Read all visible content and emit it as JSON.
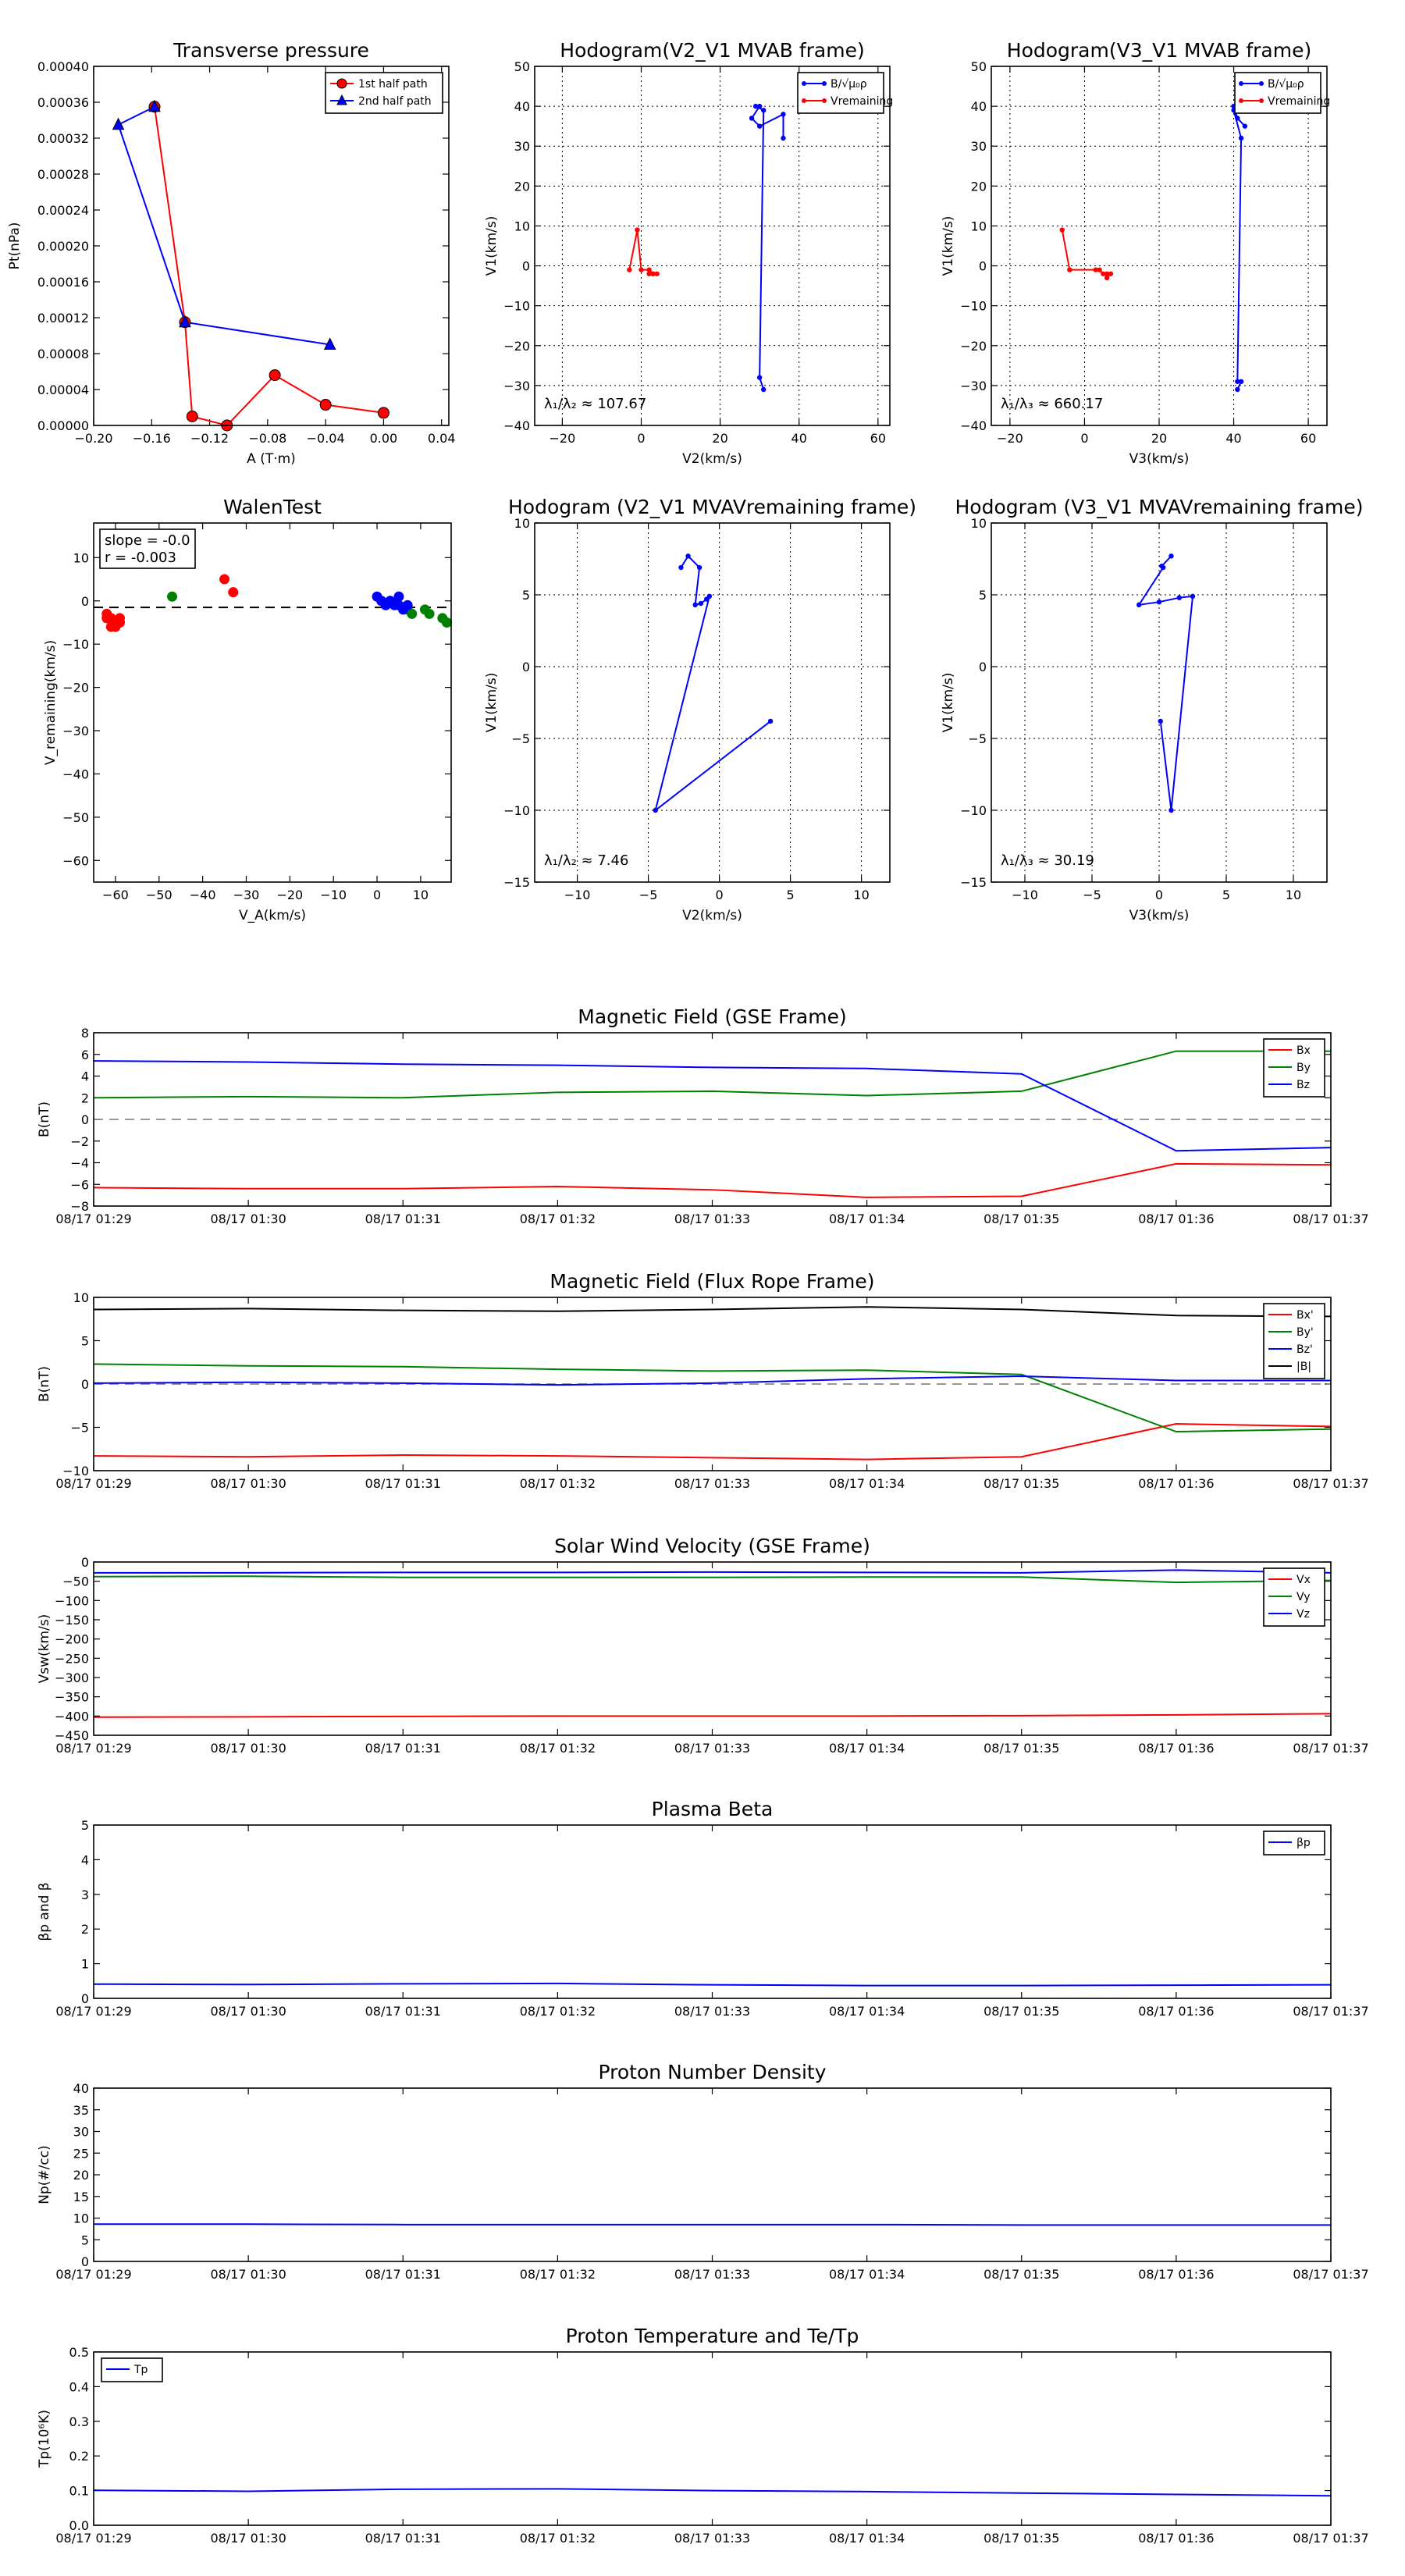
{
  "chart_data": [
    {
      "id": "transverse-pressure",
      "type": "line",
      "title": "Transverse pressure",
      "xlabel": "A (T·m)",
      "ylabel": "Pt(nPa)",
      "xlim": [
        -0.2,
        0.045
      ],
      "ylim": [
        0,
        0.0004
      ],
      "xticks": [
        -0.2,
        -0.16,
        -0.12,
        -0.08,
        -0.04,
        0.0,
        0.04
      ],
      "xtick_labels": [
        "−0.20",
        "−0.16",
        "−0.12",
        "−0.08",
        "−0.04",
        "0.00",
        "0.04"
      ],
      "yticks": [
        0,
        4e-05,
        8e-05,
        0.00012,
        0.00016,
        0.0002,
        0.00024,
        0.00028,
        0.00032,
        0.00036,
        0.0004
      ],
      "ytick_labels": [
        "0.00000",
        "0.00004",
        "0.00008",
        "0.00012",
        "0.00016",
        "0.00020",
        "0.00024",
        "0.00028",
        "0.00032",
        "0.00036",
        "0.00040"
      ],
      "grid": false,
      "legend": "top-right",
      "series": [
        {
          "name": "1st half path",
          "color": "#ff0000",
          "marker": "circle",
          "x": [
            -0.158,
            -0.137,
            -0.132,
            -0.108,
            -0.075,
            -0.04,
            0.0
          ],
          "y": [
            0.000355,
            0.000115,
            1e-05,
            0.0,
            5.6e-05,
            2.3e-05,
            1.4e-05
          ]
        },
        {
          "name": "2nd half path",
          "color": "#0000ff",
          "marker": "triangle",
          "x": [
            -0.037,
            -0.137,
            -0.183,
            -0.158
          ],
          "y": [
            9e-05,
            0.000115,
            0.000335,
            0.000355
          ]
        }
      ]
    },
    {
      "id": "hodogram-v2v1-mvab",
      "type": "line",
      "title": "Hodogram(V2_V1 MVAB frame)",
      "xlabel": "V2(km/s)",
      "ylabel": "V1(km/s)",
      "xlim": [
        -27,
        63
      ],
      "ylim": [
        -40,
        50
      ],
      "xticks": [
        -20,
        0,
        20,
        40,
        60
      ],
      "xtick_labels": [
        "−20",
        "0",
        "20",
        "40",
        "60"
      ],
      "yticks": [
        -40,
        -30,
        -20,
        -10,
        0,
        10,
        20,
        30,
        40,
        50
      ],
      "ytick_labels": [
        "−40",
        "−30",
        "−20",
        "−10",
        "0",
        "10",
        "20",
        "30",
        "40",
        "50"
      ],
      "grid": true,
      "legend": "top-right",
      "annotation": "λ₁/λ₂ ≈ 107.67",
      "series": [
        {
          "name": "B/√μ₀ρ",
          "color": "#0000ff",
          "marker": "dot",
          "x": [
            36,
            36,
            30,
            28,
            30,
            29,
            31,
            30,
            31
          ],
          "y": [
            32,
            38,
            35,
            37,
            40,
            40,
            39,
            -28,
            -31
          ]
        },
        {
          "name": "Vremaining",
          "color": "#ff0000",
          "marker": "dot",
          "x": [
            -3,
            -1,
            0,
            2,
            3,
            4,
            2,
            3
          ],
          "y": [
            -1,
            9,
            -1,
            -1,
            -2,
            -2,
            -2,
            -2
          ]
        }
      ]
    },
    {
      "id": "hodogram-v3v1-mvab",
      "type": "line",
      "title": "Hodogram(V3_V1 MVAB frame)",
      "xlabel": "V3(km/s)",
      "ylabel": "V1(km/s)",
      "xlim": [
        -25,
        65
      ],
      "ylim": [
        -40,
        50
      ],
      "xticks": [
        -20,
        0,
        20,
        40,
        60
      ],
      "xtick_labels": [
        "−20",
        "0",
        "20",
        "40",
        "60"
      ],
      "yticks": [
        -40,
        -30,
        -20,
        -10,
        0,
        10,
        20,
        30,
        40,
        50
      ],
      "ytick_labels": [
        "−40",
        "−30",
        "−20",
        "−10",
        "0",
        "10",
        "20",
        "30",
        "40",
        "50"
      ],
      "grid": true,
      "legend": "top-right",
      "annotation": "λ₁/λ₃ ≈ 660.17",
      "series": [
        {
          "name": "B/√μ₀ρ",
          "color": "#0000ff",
          "marker": "dot",
          "x": [
            43,
            41,
            40,
            41,
            40,
            42,
            41,
            42,
            41
          ],
          "y": [
            35,
            37,
            40,
            40,
            39,
            32,
            -29,
            -29,
            -31
          ]
        },
        {
          "name": "Vremaining",
          "color": "#ff0000",
          "marker": "dot",
          "x": [
            -6,
            -4,
            3,
            4,
            5,
            6,
            7,
            6
          ],
          "y": [
            9,
            -1,
            -1,
            -1,
            -2,
            -2,
            -2,
            -3
          ]
        }
      ]
    },
    {
      "id": "walen-test",
      "type": "scatter",
      "title": "WalenTest",
      "xlabel": "V_A(km/s)",
      "ylabel": "V_remaining(km/s)",
      "xlim": [
        -65,
        17
      ],
      "ylim": [
        -65,
        18
      ],
      "xticks": [
        -60,
        -50,
        -40,
        -30,
        -20,
        -10,
        0,
        10
      ],
      "xtick_labels": [
        "−60",
        "−50",
        "−40",
        "−30",
        "−20",
        "−10",
        "0",
        "10"
      ],
      "yticks": [
        -60,
        -50,
        -40,
        -30,
        -20,
        -10,
        0,
        10
      ],
      "ytick_labels": [
        "−60",
        "−50",
        "−40",
        "−30",
        "−20",
        "−10",
        "0",
        "10"
      ],
      "grid": false,
      "fit_line": {
        "slope": -0.0,
        "intercept": -1.5
      },
      "annotation_lines": [
        "slope = -0.0",
        "r = -0.003"
      ],
      "series": [
        {
          "color": "#ff0000",
          "x": [
            -62,
            -61,
            -60,
            -59,
            -60,
            -61,
            -62,
            -59,
            -35,
            -33
          ],
          "y": [
            -3,
            -4,
            -6,
            -4,
            -5,
            -6,
            -4,
            -5,
            5,
            2
          ]
        },
        {
          "color": "#008000",
          "x": [
            -47,
            7,
            8,
            11,
            12,
            15,
            16
          ],
          "y": [
            1,
            -2,
            -3,
            -2,
            -3,
            -4,
            -5
          ]
        },
        {
          "color": "#0000ff",
          "x": [
            0,
            1,
            2,
            3,
            4,
            5,
            5,
            6,
            7
          ],
          "y": [
            1,
            0,
            -1,
            0,
            -1,
            1,
            -1,
            -2,
            -1
          ]
        }
      ]
    },
    {
      "id": "hodogram-v2v1-mvav",
      "type": "line",
      "title": "Hodogram (V2_V1 MVAVremaining frame)",
      "xlabel": "V2(km/s)",
      "ylabel": "V1(km/s)",
      "xlim": [
        -13,
        12
      ],
      "ylim": [
        -15,
        10
      ],
      "xticks": [
        -10,
        -5,
        0,
        5,
        10
      ],
      "xtick_labels": [
        "−10",
        "−5",
        "0",
        "5",
        "10"
      ],
      "yticks": [
        -15,
        -10,
        -5,
        0,
        5,
        10
      ],
      "ytick_labels": [
        "−15",
        "−10",
        "−5",
        "0",
        "5",
        "10"
      ],
      "grid": true,
      "annotation": "λ₁/λ₂ ≈ 7.46",
      "series": [
        {
          "color": "#0000ff",
          "marker": "dot",
          "x": [
            -2.7,
            -2.2,
            -1.4,
            -1.7,
            -1.3,
            -0.9,
            -0.7,
            -4.5,
            3.6
          ],
          "y": [
            6.9,
            7.7,
            6.9,
            4.3,
            4.4,
            4.7,
            4.9,
            -10.0,
            -3.8
          ]
        }
      ]
    },
    {
      "id": "hodogram-v3v1-mvav",
      "type": "line",
      "title": "Hodogram (V3_V1 MVAVremaining frame)",
      "xlabel": "V3(km/s)",
      "ylabel": "V1(km/s)",
      "xlim": [
        -12.5,
        12.5
      ],
      "ylim": [
        -15,
        10
      ],
      "xticks": [
        -10,
        -5,
        0,
        5,
        10
      ],
      "xtick_labels": [
        "−10",
        "−5",
        "0",
        "5",
        "10"
      ],
      "yticks": [
        -15,
        -10,
        -5,
        0,
        5,
        10
      ],
      "ytick_labels": [
        "−15",
        "−10",
        "−5",
        "0",
        "5",
        "10"
      ],
      "grid": true,
      "annotation": "λ₁/λ₃ ≈ 30.19",
      "series": [
        {
          "color": "#0000ff",
          "marker": "dot",
          "x": [
            0.9,
            0.2,
            0.3,
            -1.5,
            0,
            1.5,
            2.5,
            0.9,
            0.1
          ],
          "y": [
            7.7,
            7.0,
            6.9,
            4.3,
            4.5,
            4.8,
            4.9,
            -10.0,
            -3.8
          ]
        }
      ]
    },
    {
      "id": "magnetic-field-gse",
      "type": "line",
      "title": "Magnetic Field (GSE Frame)",
      "ylabel": "B(nT)",
      "x": [
        0,
        1,
        2,
        3,
        4,
        5,
        6,
        7,
        8
      ],
      "xlim": [
        0,
        8
      ],
      "xtick_labels": [
        "08/17 01:29",
        "08/17 01:30",
        "08/17 01:31",
        "08/17 01:32",
        "08/17 01:33",
        "08/17 01:34",
        "08/17 01:35",
        "08/17 01:36",
        "08/17 01:37"
      ],
      "ylim": [
        -8,
        8
      ],
      "yticks": [
        -8,
        -6,
        -4,
        -2,
        0,
        2,
        4,
        6,
        8
      ],
      "ytick_labels": [
        "−8",
        "−6",
        "−4",
        "−2",
        "0",
        "2",
        "4",
        "6",
        "8"
      ],
      "zero_line": true,
      "legend": "top-right",
      "series": [
        {
          "name": "Bx",
          "color": "#ff0000",
          "values": [
            -6.3,
            -6.4,
            -6.4,
            -6.2,
            -6.5,
            -7.2,
            -7.1,
            -4.1,
            -4.2
          ]
        },
        {
          "name": "By",
          "color": "#008000",
          "values": [
            2.0,
            2.1,
            2.0,
            2.5,
            2.6,
            2.2,
            2.6,
            6.3,
            6.3
          ]
        },
        {
          "name": "Bz",
          "color": "#0000ff",
          "values": [
            5.4,
            5.3,
            5.1,
            5.0,
            4.8,
            4.7,
            4.2,
            -2.9,
            -2.6
          ]
        }
      ]
    },
    {
      "id": "magnetic-field-flux-rope",
      "type": "line",
      "title": "Magnetic Field (Flux Rope Frame)",
      "ylabel": "B(nT)",
      "x": [
        0,
        1,
        2,
        3,
        4,
        5,
        6,
        7,
        8
      ],
      "xlim": [
        0,
        8
      ],
      "xtick_labels": [
        "08/17 01:29",
        "08/17 01:30",
        "08/17 01:31",
        "08/17 01:32",
        "08/17 01:33",
        "08/17 01:34",
        "08/17 01:35",
        "08/17 01:36",
        "08/17 01:37"
      ],
      "ylim": [
        -10,
        10
      ],
      "yticks": [
        -10,
        -5,
        0,
        5,
        10
      ],
      "ytick_labels": [
        "−10",
        "−5",
        "0",
        "5",
        "10"
      ],
      "zero_line": true,
      "legend": "top-right",
      "series": [
        {
          "name": "Bx'",
          "color": "#ff0000",
          "values": [
            -8.3,
            -8.4,
            -8.2,
            -8.3,
            -8.5,
            -8.7,
            -8.4,
            -4.6,
            -4.9
          ]
        },
        {
          "name": "By'",
          "color": "#008000",
          "values": [
            2.3,
            2.1,
            2.0,
            1.7,
            1.5,
            1.6,
            1.1,
            -5.5,
            -5.2
          ]
        },
        {
          "name": "Bz'",
          "color": "#0000ff",
          "values": [
            0.1,
            0.2,
            0.1,
            -0.1,
            0.1,
            0.6,
            0.9,
            0.4,
            0.4
          ]
        },
        {
          "name": "|B|",
          "color": "#000000",
          "values": [
            8.6,
            8.7,
            8.5,
            8.4,
            8.6,
            8.9,
            8.6,
            7.9,
            7.8
          ]
        }
      ]
    },
    {
      "id": "solar-wind-velocity",
      "type": "line",
      "title": "Solar Wind Velocity (GSE Frame)",
      "ylabel": "Vsw(km/s)",
      "x": [
        0,
        1,
        2,
        3,
        4,
        5,
        6,
        7,
        8
      ],
      "xlim": [
        0,
        8
      ],
      "xtick_labels": [
        "08/17 01:29",
        "08/17 01:30",
        "08/17 01:31",
        "08/17 01:32",
        "08/17 01:33",
        "08/17 01:34",
        "08/17 01:35",
        "08/17 01:36",
        "08/17 01:37"
      ],
      "ylim": [
        -450,
        0
      ],
      "yticks": [
        -450,
        -400,
        -350,
        -300,
        -250,
        -200,
        -150,
        -100,
        -50,
        0
      ],
      "ytick_labels": [
        "−450",
        "−400",
        "−350",
        "−300",
        "−250",
        "−200",
        "−150",
        "−100",
        "−50",
        "0"
      ],
      "legend": "top-right",
      "series": [
        {
          "name": "Vx",
          "color": "#ff0000",
          "values": [
            -403,
            -402,
            -401,
            -400,
            -400,
            -400,
            -399,
            -397,
            -394
          ]
        },
        {
          "name": "Vy",
          "color": "#008000",
          "values": [
            -38,
            -37,
            -40,
            -40,
            -40,
            -39,
            -39,
            -53,
            -48
          ]
        },
        {
          "name": "Vz",
          "color": "#0000ff",
          "values": [
            -28,
            -28,
            -27,
            -27,
            -26,
            -27,
            -28,
            -21,
            -28
          ]
        }
      ]
    },
    {
      "id": "plasma-beta",
      "type": "line",
      "title": "Plasma Beta",
      "ylabel": "βp and β",
      "x": [
        0,
        1,
        2,
        3,
        4,
        5,
        6,
        7,
        8
      ],
      "xlim": [
        0,
        8
      ],
      "xtick_labels": [
        "08/17 01:29",
        "08/17 01:30",
        "08/17 01:31",
        "08/17 01:32",
        "08/17 01:33",
        "08/17 01:34",
        "08/17 01:35",
        "08/17 01:36",
        "08/17 01:37"
      ],
      "ylim": [
        0,
        5
      ],
      "yticks": [
        0,
        1,
        2,
        3,
        4,
        5
      ],
      "ytick_labels": [
        "0",
        "1",
        "2",
        "3",
        "4",
        "5"
      ],
      "legend": "top-right",
      "series": [
        {
          "name": "βp",
          "color": "#0000ff",
          "values": [
            0.41,
            0.4,
            0.42,
            0.43,
            0.39,
            0.37,
            0.37,
            0.38,
            0.39
          ]
        }
      ]
    },
    {
      "id": "proton-density",
      "type": "line",
      "title": "Proton Number Density",
      "ylabel": "Np(#/cc)",
      "x": [
        0,
        1,
        2,
        3,
        4,
        5,
        6,
        7,
        8
      ],
      "xlim": [
        0,
        8
      ],
      "xtick_labels": [
        "08/17 01:29",
        "08/17 01:30",
        "08/17 01:31",
        "08/17 01:32",
        "08/17 01:33",
        "08/17 01:34",
        "08/17 01:35",
        "08/17 01:36",
        "08/17 01:37"
      ],
      "ylim": [
        0,
        40
      ],
      "yticks": [
        0,
        5,
        10,
        15,
        20,
        25,
        30,
        35,
        40
      ],
      "ytick_labels": [
        "0",
        "5",
        "10",
        "15",
        "20",
        "25",
        "30",
        "35",
        "40"
      ],
      "series": [
        {
          "color": "#0000ff",
          "values": [
            8.6,
            8.6,
            8.5,
            8.5,
            8.5,
            8.5,
            8.4,
            8.4,
            8.4
          ]
        }
      ]
    },
    {
      "id": "proton-temperature",
      "type": "line",
      "title": "Proton Temperature and Te/Tp",
      "ylabel": "Tp(10⁶K)",
      "x": [
        0,
        1,
        2,
        3,
        4,
        5,
        6,
        7,
        8
      ],
      "xlim": [
        0,
        8
      ],
      "xtick_labels": [
        "08/17 01:29",
        "08/17 01:30",
        "08/17 01:31",
        "08/17 01:32",
        "08/17 01:33",
        "08/17 01:34",
        "08/17 01:35",
        "08/17 01:36",
        "08/17 01:37"
      ],
      "ylim": [
        0,
        0.5
      ],
      "yticks": [
        0,
        0.1,
        0.2,
        0.3,
        0.4,
        0.5
      ],
      "ytick_labels": [
        "0.0",
        "0.1",
        "0.2",
        "0.3",
        "0.4",
        "0.5"
      ],
      "legend": "top-left",
      "series": [
        {
          "name": "Tp",
          "color": "#0000ff",
          "values": [
            0.101,
            0.098,
            0.104,
            0.105,
            0.1,
            0.097,
            0.093,
            0.089,
            0.085
          ]
        }
      ]
    }
  ]
}
